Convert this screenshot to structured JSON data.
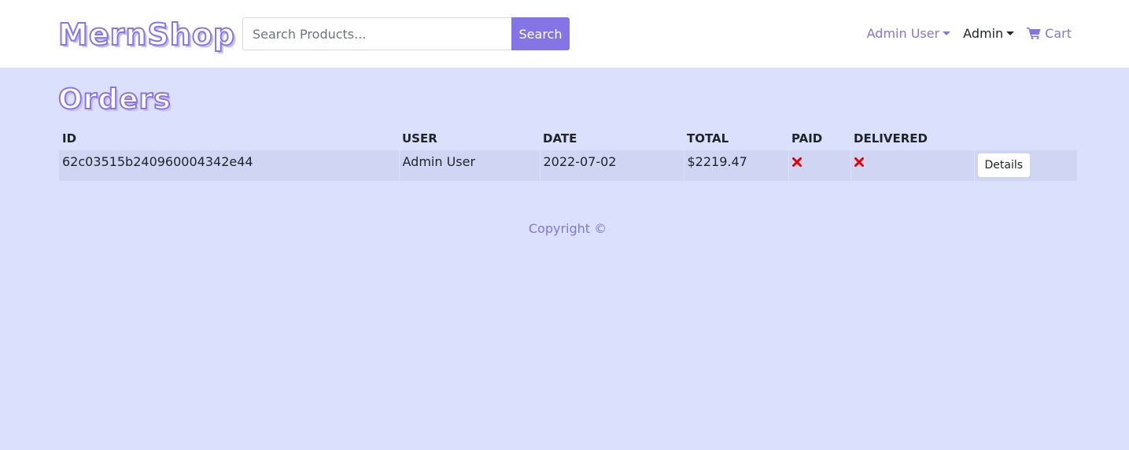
{
  "navbar": {
    "brand": "MernShop",
    "search_placeholder": "Search Products...",
    "search_button": "Search",
    "user_menu": "Admin User",
    "admin_menu": "Admin",
    "cart": "Cart",
    "cart_icon": "shopping-cart-icon"
  },
  "page": {
    "title": "Orders"
  },
  "table": {
    "headers": [
      "ID",
      "USER",
      "DATE",
      "TOTAL",
      "PAID",
      "DELIVERED",
      ""
    ],
    "rows": [
      {
        "id": "62c03515b240960004342e44",
        "user": "Admin User",
        "date": "2022-07-02",
        "total": "$2219.47",
        "paid_icon": "cross-icon",
        "delivered_icon": "cross-icon",
        "details_label": "Details"
      }
    ]
  },
  "footer": {
    "copyright": "Copyright ©"
  },
  "colors": {
    "accent": "#8474e6",
    "background": "#dbe0fd",
    "row": "#d1d5f4",
    "cross": "#e60000"
  }
}
